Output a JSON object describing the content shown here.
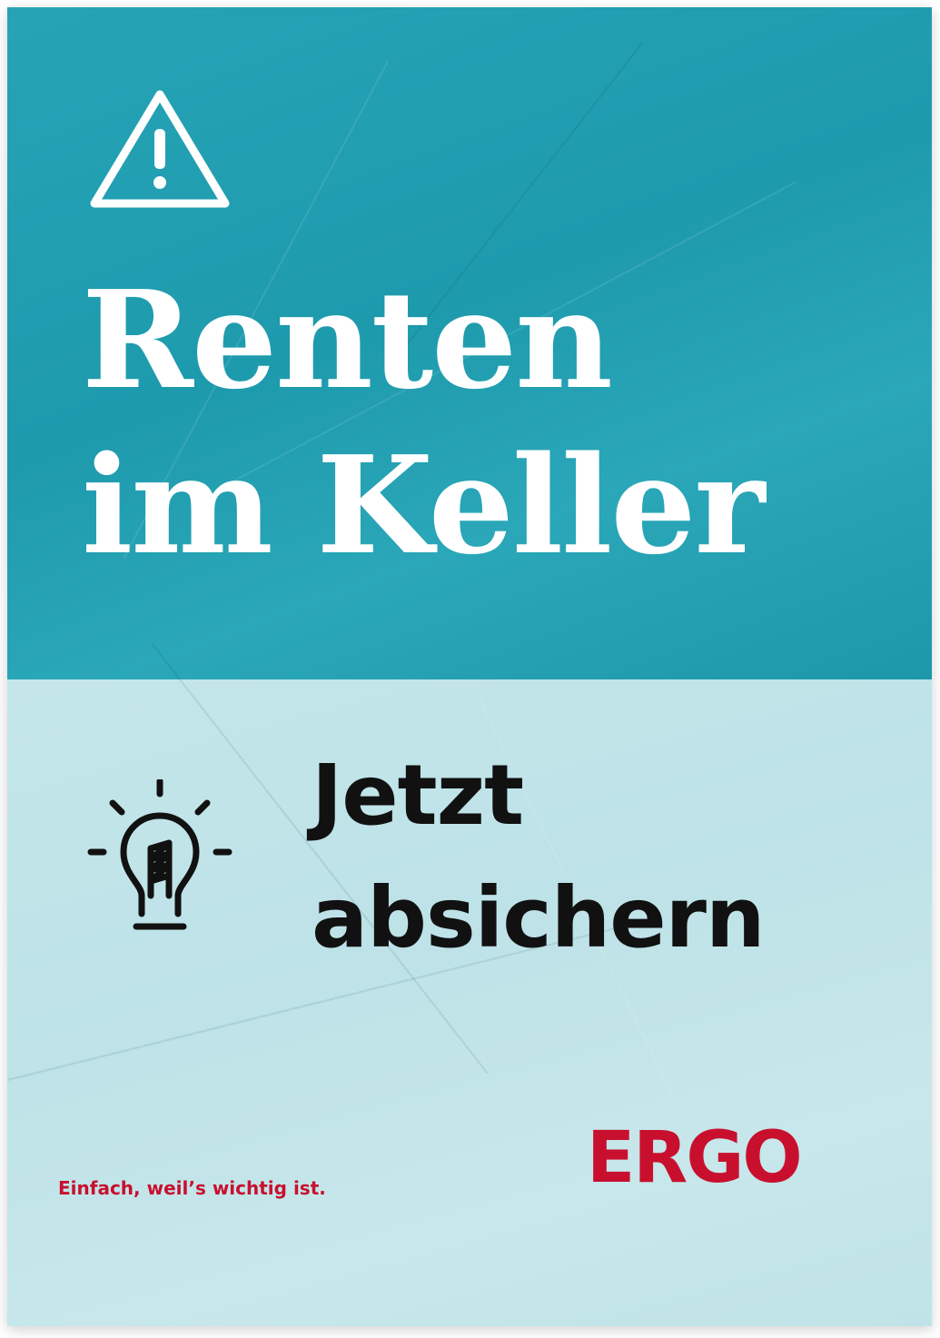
{
  "poster": {
    "headline_line1": "Renten",
    "headline_line2": "im Keller",
    "cta_line1": "Jetzt",
    "cta_line2": "absichern",
    "logo_text": "ERGO",
    "tagline": "Einfach, weil’s wichtig ist.",
    "icons": [
      "warning-triangle-icon",
      "lightbulb-icon"
    ],
    "colors": {
      "top_background": "#1e9aad",
      "bottom_background": "#c4e6ea",
      "headline_text": "#ffffff",
      "cta_text": "#111111",
      "brand_red": "#c8102e"
    }
  }
}
